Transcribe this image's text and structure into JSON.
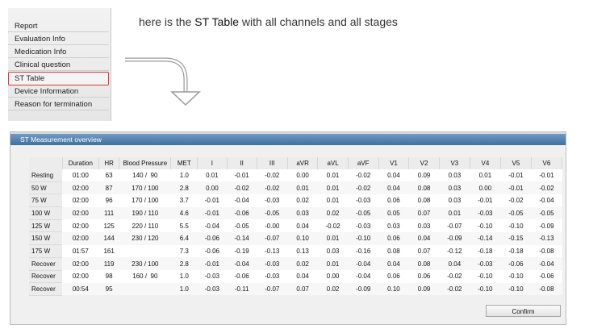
{
  "menu": {
    "items": [
      {
        "label": "Report"
      },
      {
        "label": "Evaluation Info"
      },
      {
        "label": "Medication Info"
      },
      {
        "label": "Clinical question"
      },
      {
        "label": "ST Table",
        "active": true
      },
      {
        "label": "Device Information"
      },
      {
        "label": "Reason for termination"
      }
    ],
    "highlight_color": "#d83a3a"
  },
  "caption": {
    "prefix": "here is the ",
    "emphasis": "ST Table",
    "suffix": " with all channels and all stages"
  },
  "dialog": {
    "title": "ST Measurement overview",
    "confirm_label": "Confirm",
    "title_color": "#4a7aa8"
  },
  "table": {
    "headers": [
      "",
      "Duration",
      "HR",
      "Blood Pressure",
      "MET",
      "I",
      "II",
      "III",
      "aVR",
      "aVL",
      "aVF",
      "V1",
      "V2",
      "V3",
      "V4",
      "V5",
      "V6"
    ],
    "rows": [
      [
        "Resting",
        "01:00",
        "63",
        "140 /  90",
        "1.0",
        "0.01",
        "-0.01",
        "-0.02",
        "0.00",
        "0.01",
        "-0.02",
        "0.04",
        "0.09",
        "0.03",
        "0.01",
        "-0.01",
        "-0.01"
      ],
      [
        "50 W",
        "02:00",
        "87",
        "170 / 100",
        "2.8",
        "0.00",
        "-0.02",
        "-0.02",
        "0.01",
        "0.01",
        "-0.02",
        "0.04",
        "0.08",
        "0.03",
        "0.00",
        "-0.01",
        "-0.02"
      ],
      [
        "75 W",
        "02:00",
        "96",
        "170 / 100",
        "3.7",
        "-0.01",
        "-0.04",
        "-0.03",
        "0.02",
        "0.01",
        "-0.03",
        "0.06",
        "0.08",
        "0.03",
        "-0.01",
        "-0.02",
        "-0.04"
      ],
      [
        "100 W",
        "02:00",
        "111",
        "190 / 110",
        "4.6",
        "-0.01",
        "-0.06",
        "-0.05",
        "0.03",
        "0.02",
        "-0.05",
        "0.05",
        "0.07",
        "0.01",
        "-0.03",
        "-0.05",
        "-0.05"
      ],
      [
        "125 W",
        "02:00",
        "125",
        "220 / 110",
        "5.5",
        "-0.04",
        "-0.05",
        "-0.00",
        "0.04",
        "-0.02",
        "-0.03",
        "0.03",
        "0.03",
        "-0.07",
        "-0.10",
        "-0.10",
        "-0.09"
      ],
      [
        "150 W",
        "02:00",
        "144",
        "230 / 120",
        "6.4",
        "-0.06",
        "-0.14",
        "-0.07",
        "0.10",
        "0.01",
        "-0.10",
        "0.06",
        "0.04",
        "-0.09",
        "-0.14",
        "-0.15",
        "-0.13"
      ],
      [
        "175 W",
        "01:57",
        "161",
        "",
        "7.3",
        "-0.06",
        "-0.19",
        "-0.13",
        "0.13",
        "0.03",
        "-0.16",
        "0.08",
        "0.07",
        "-0.12",
        "-0.18",
        "-0.18",
        "-0.08"
      ],
      [
        "Recover",
        "02:00",
        "119",
        "230 / 100",
        "2.8",
        "-0.01",
        "-0.04",
        "-0.03",
        "0.02",
        "0.01",
        "-0.04",
        "0.04",
        "0.08",
        "0.04",
        "-0.03",
        "-0.06",
        "-0.04"
      ],
      [
        "Recover",
        "02:00",
        "98",
        "160 /  90",
        "1.0",
        "-0.03",
        "-0.06",
        "-0.03",
        "0.04",
        "0.00",
        "-0.04",
        "0.06",
        "0.06",
        "-0.02",
        "-0.10",
        "-0.10",
        "-0.06"
      ],
      [
        "Recover",
        "00:54",
        "95",
        "",
        "1.0",
        "-0.03",
        "-0.11",
        "-0.07",
        "0.07",
        "0.02",
        "-0.09",
        "0.10",
        "0.09",
        "-0.02",
        "-0.10",
        "-0.10",
        "-0.08"
      ]
    ]
  }
}
